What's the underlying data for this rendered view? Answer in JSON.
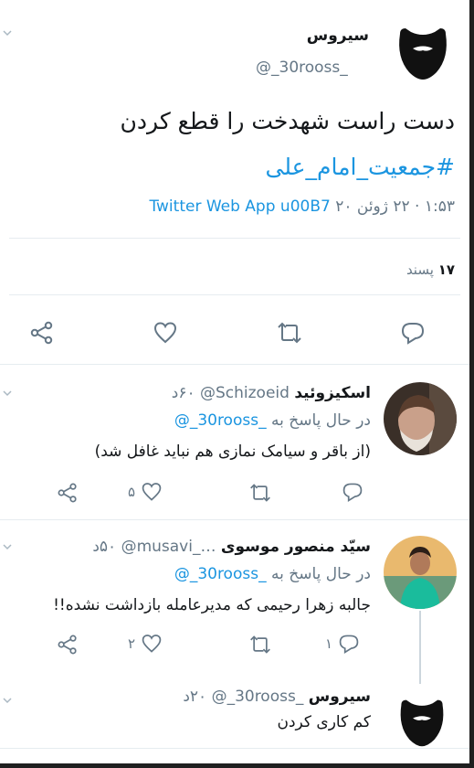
{
  "main_tweet": {
    "author_name": "سیروس",
    "author_handle": "@_30rooss_",
    "text": "دست راست شهدخت را قطع کردن",
    "hashtag": "#جمعیت_امام_علی",
    "timestamp": "۱:۵۳ · ۲۲ ژوئن ۲۰",
    "source_separator": "u00B7",
    "source": "Twitter Web App",
    "likes_count": "۱۷",
    "likes_label": "پسند",
    "avatar_icon": "beard-avatar-icon"
  },
  "actions_icons": [
    "reply-icon",
    "retweet-icon",
    "like-icon",
    "share-icon"
  ],
  "replies": [
    {
      "author_name": "اسکیزوئید",
      "author_handle": "@Schizoeid",
      "time": "۶۰د",
      "reply_to_prefix": "در حال پاسخ به",
      "reply_to_handle": "@_30rooss_",
      "text": "(از باقر و سیامک نمازی هم نباید غافل شد)",
      "reply_count": "",
      "like_count": "۵"
    },
    {
      "author_name": "سیّد منصور موسوی",
      "author_handle": "@musavi_…",
      "time": "۵۰د",
      "reply_to_prefix": "در حال پاسخ به",
      "reply_to_handle": "@_30rooss_",
      "text": "جالبه زهرا رحیمی که مدیرعامله بازداشت نشده!!",
      "reply_count": "۱",
      "like_count": "۲"
    },
    {
      "author_name": "سیروس",
      "author_handle": "@_30rooss_",
      "time": "۲۰د",
      "text": "کم کاری کردن"
    }
  ]
}
